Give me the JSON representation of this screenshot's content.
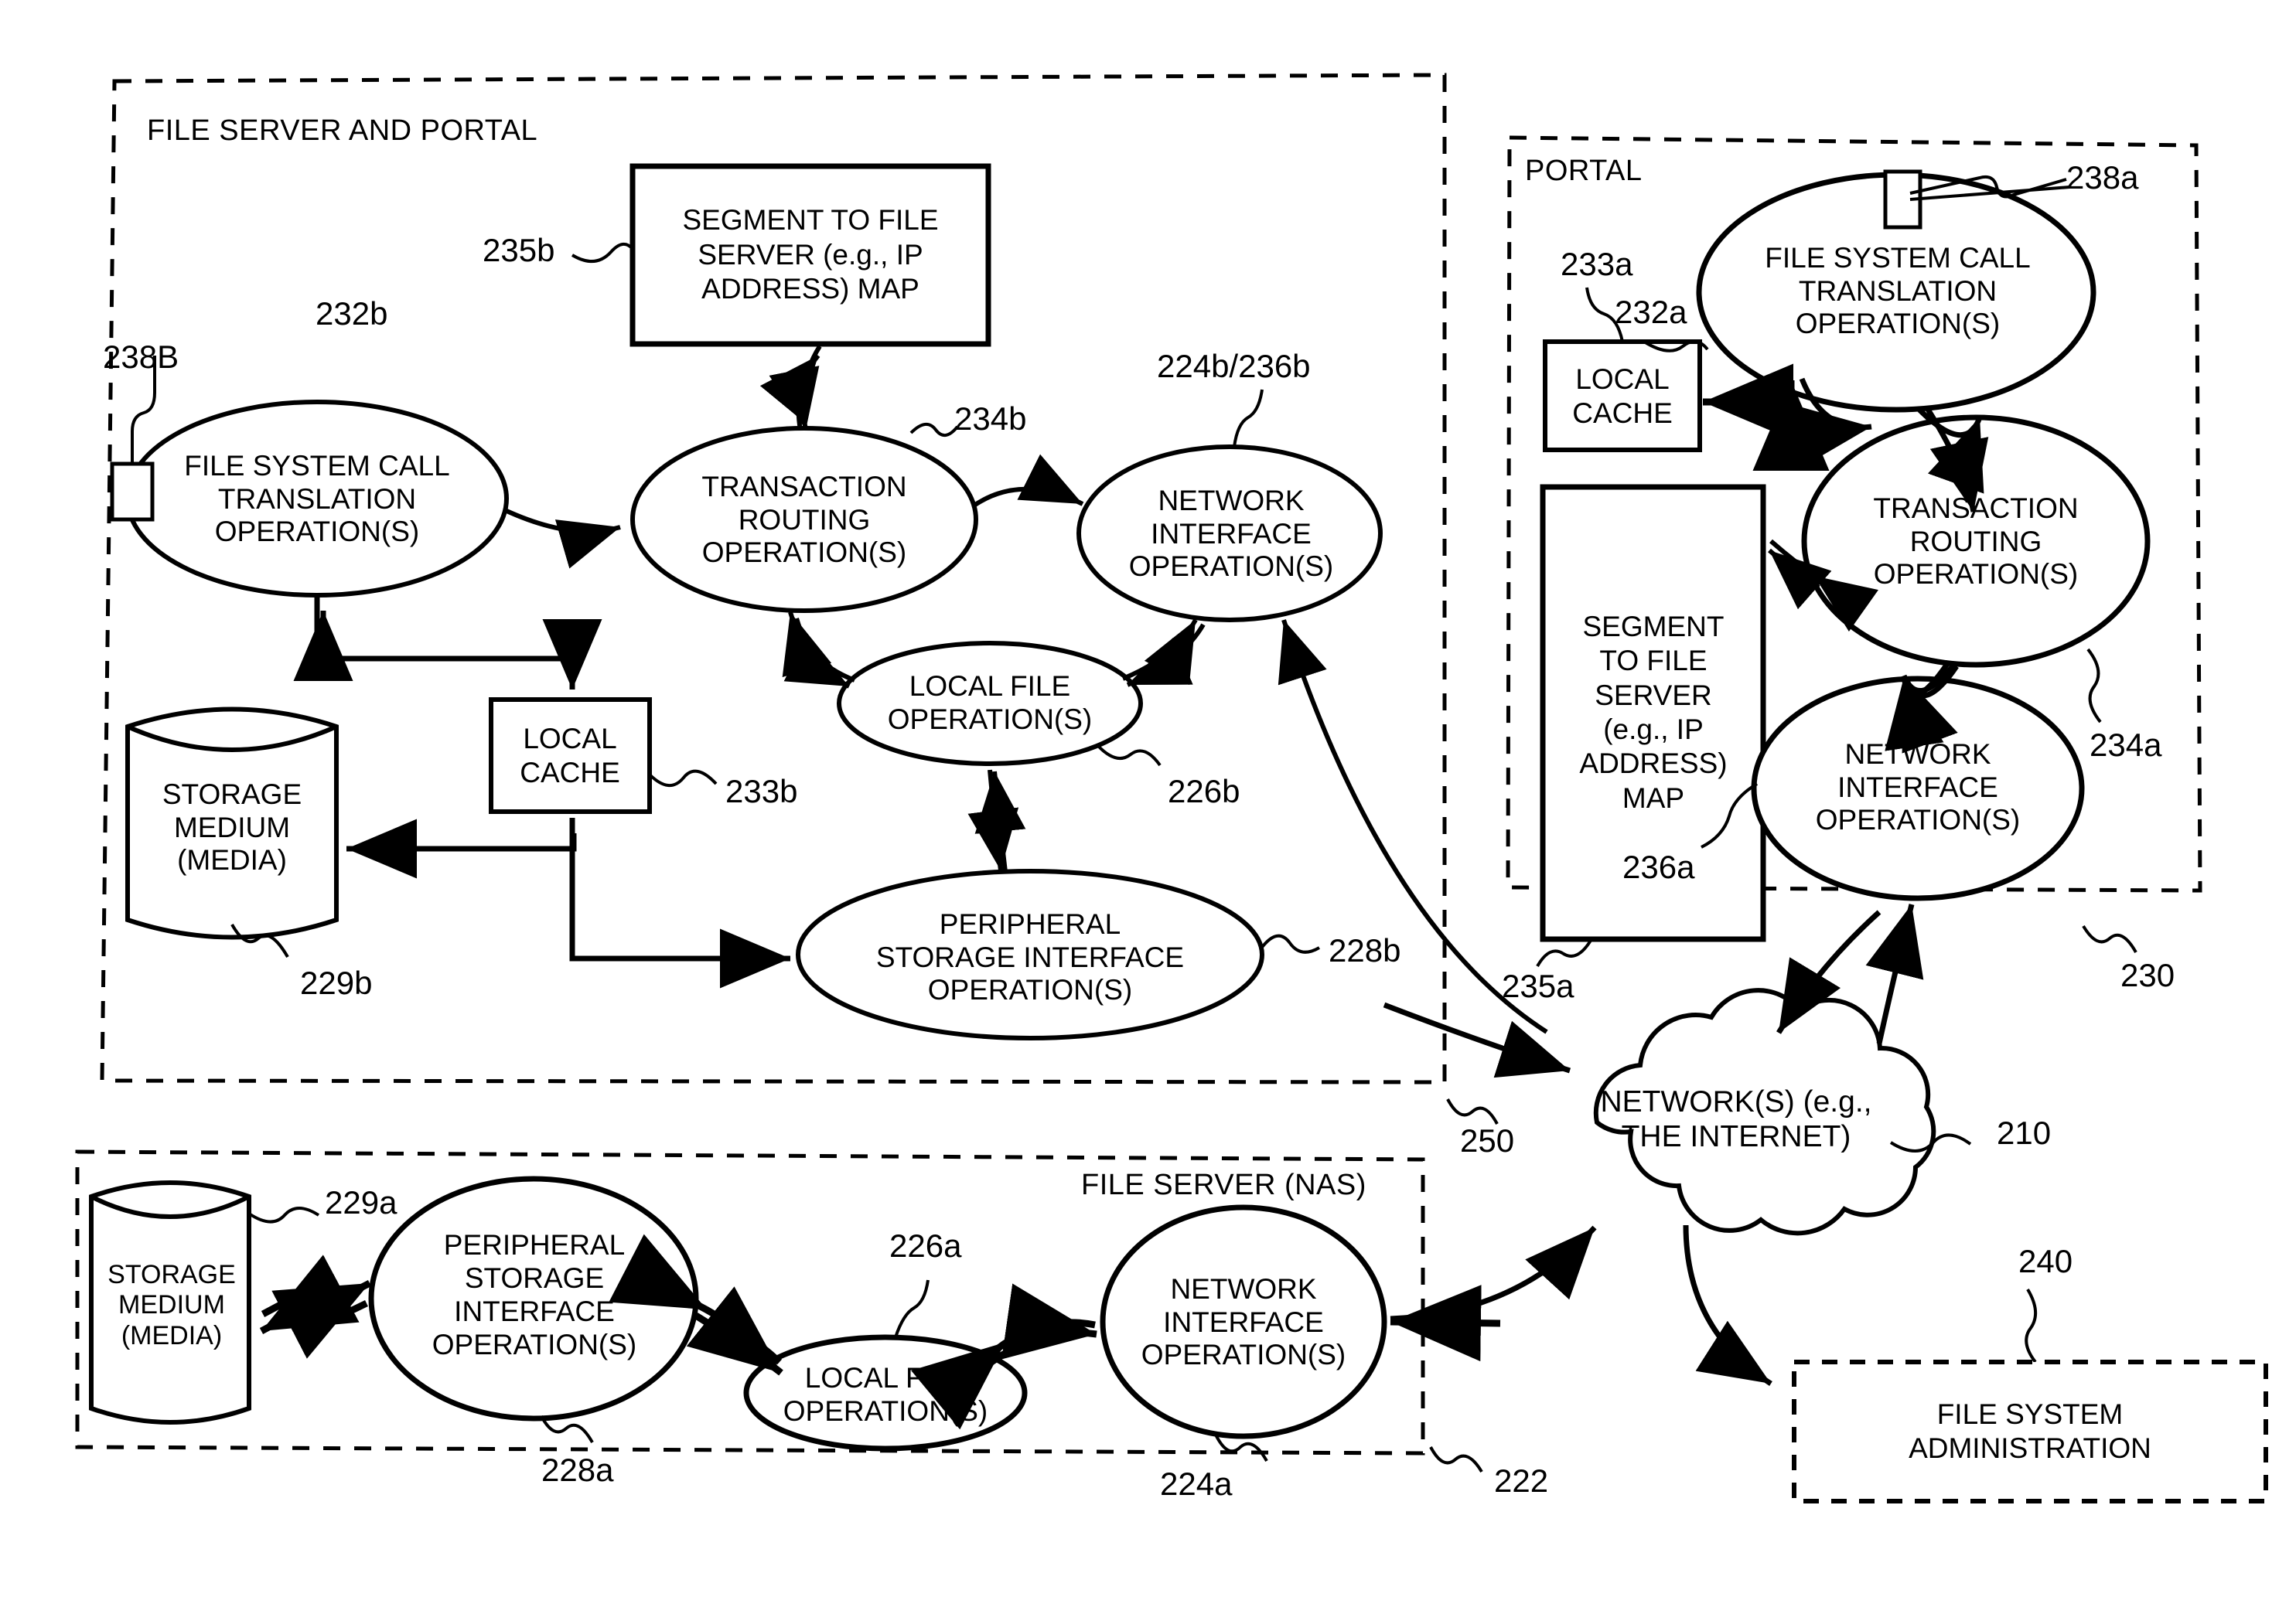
{
  "figure": {
    "type": "patent-block-diagram",
    "panels": [
      {
        "id": "file-server-and-portal",
        "label": "FILE SERVER AND PORTAL",
        "ref": "250"
      },
      {
        "id": "portal",
        "label": "PORTAL",
        "ref": "230"
      },
      {
        "id": "file-server-nas",
        "label": "FILE SERVER (NAS)",
        "ref": "222"
      }
    ]
  },
  "left_panel": {
    "title": "FILE SERVER AND PORTAL",
    "ref": "250",
    "nodes": {
      "fs_call_translation": {
        "text": "FILE SYSTEM CALL\nTRANSLATION\nOPERATION(S)",
        "ref": "232b"
      },
      "segment_map": {
        "text": "SEGMENT TO FILE\nSERVER (e.g., IP\nADDRESS) MAP",
        "ref": "235b"
      },
      "transaction_routing": {
        "text": "TRANSACTION\nROUTING\nOPERATION(S)",
        "ref": "234b"
      },
      "network_interface": {
        "text": "NETWORK\nINTERFACE\nOPERATION(S)",
        "ref": "224b/236b"
      },
      "local_file_ops": {
        "text": "LOCAL FILE\nOPERATION(S)",
        "ref": "226b"
      },
      "peripheral_storage": {
        "text": "PERIPHERAL\nSTORAGE INTERFACE\nOPERATION(S)",
        "ref": "228b"
      },
      "local_cache": {
        "text": "LOCAL\nCACHE",
        "ref": "233b"
      },
      "storage_medium": {
        "text": "STORAGE\nMEDIUM\n(MEDIA)",
        "ref": "229b"
      },
      "port_marker": {
        "ref": "238B"
      }
    }
  },
  "right_panel": {
    "title": "PORTAL",
    "ref": "230",
    "nodes": {
      "fs_call_translation": {
        "text": "FILE SYSTEM CALL\nTRANSLATION\nOPERATION(S)",
        "ref": "232a"
      },
      "local_cache": {
        "text": "LOCAL\nCACHE",
        "ref": "233a"
      },
      "segment_map": {
        "text": "SEGMENT\nTO FILE\nSERVER\n(e.g., IP\nADDRESS)\nMAP",
        "ref": "235a"
      },
      "transaction_routing": {
        "text": "TRANSACTION\nROUTING\nOPERATION(S)",
        "ref": "234a"
      },
      "network_interface": {
        "text": "NETWORK\nINTERFACE\nOPERATION(S)",
        "ref": "236a"
      },
      "port_marker": {
        "ref": "238a"
      }
    }
  },
  "bottom_panel": {
    "title": "FILE SERVER (NAS)",
    "ref": "222",
    "nodes": {
      "storage_medium": {
        "text": "STORAGE\nMEDIUM\n(MEDIA)",
        "ref": "229a"
      },
      "peripheral_storage": {
        "text": "PERIPHERAL\nSTORAGE\nINTERFACE\nOPERATION(S)",
        "ref": "228a"
      },
      "local_file_ops": {
        "text": "LOCAL FILE\nOPERATION(S)",
        "ref": "226a"
      },
      "network_interface": {
        "text": "NETWORK\nINTERFACE\nOPERATION(S)",
        "ref": "224a"
      }
    }
  },
  "network": {
    "cloud": {
      "text": "NETWORK(S) (e.g.,\nTHE INTERNET)",
      "ref": "210"
    },
    "administration": {
      "text": "FILE SYSTEM\nADMINISTRATION",
      "ref": "240"
    }
  },
  "colors": {
    "ink": "#000000",
    "paper": "#ffffff"
  }
}
